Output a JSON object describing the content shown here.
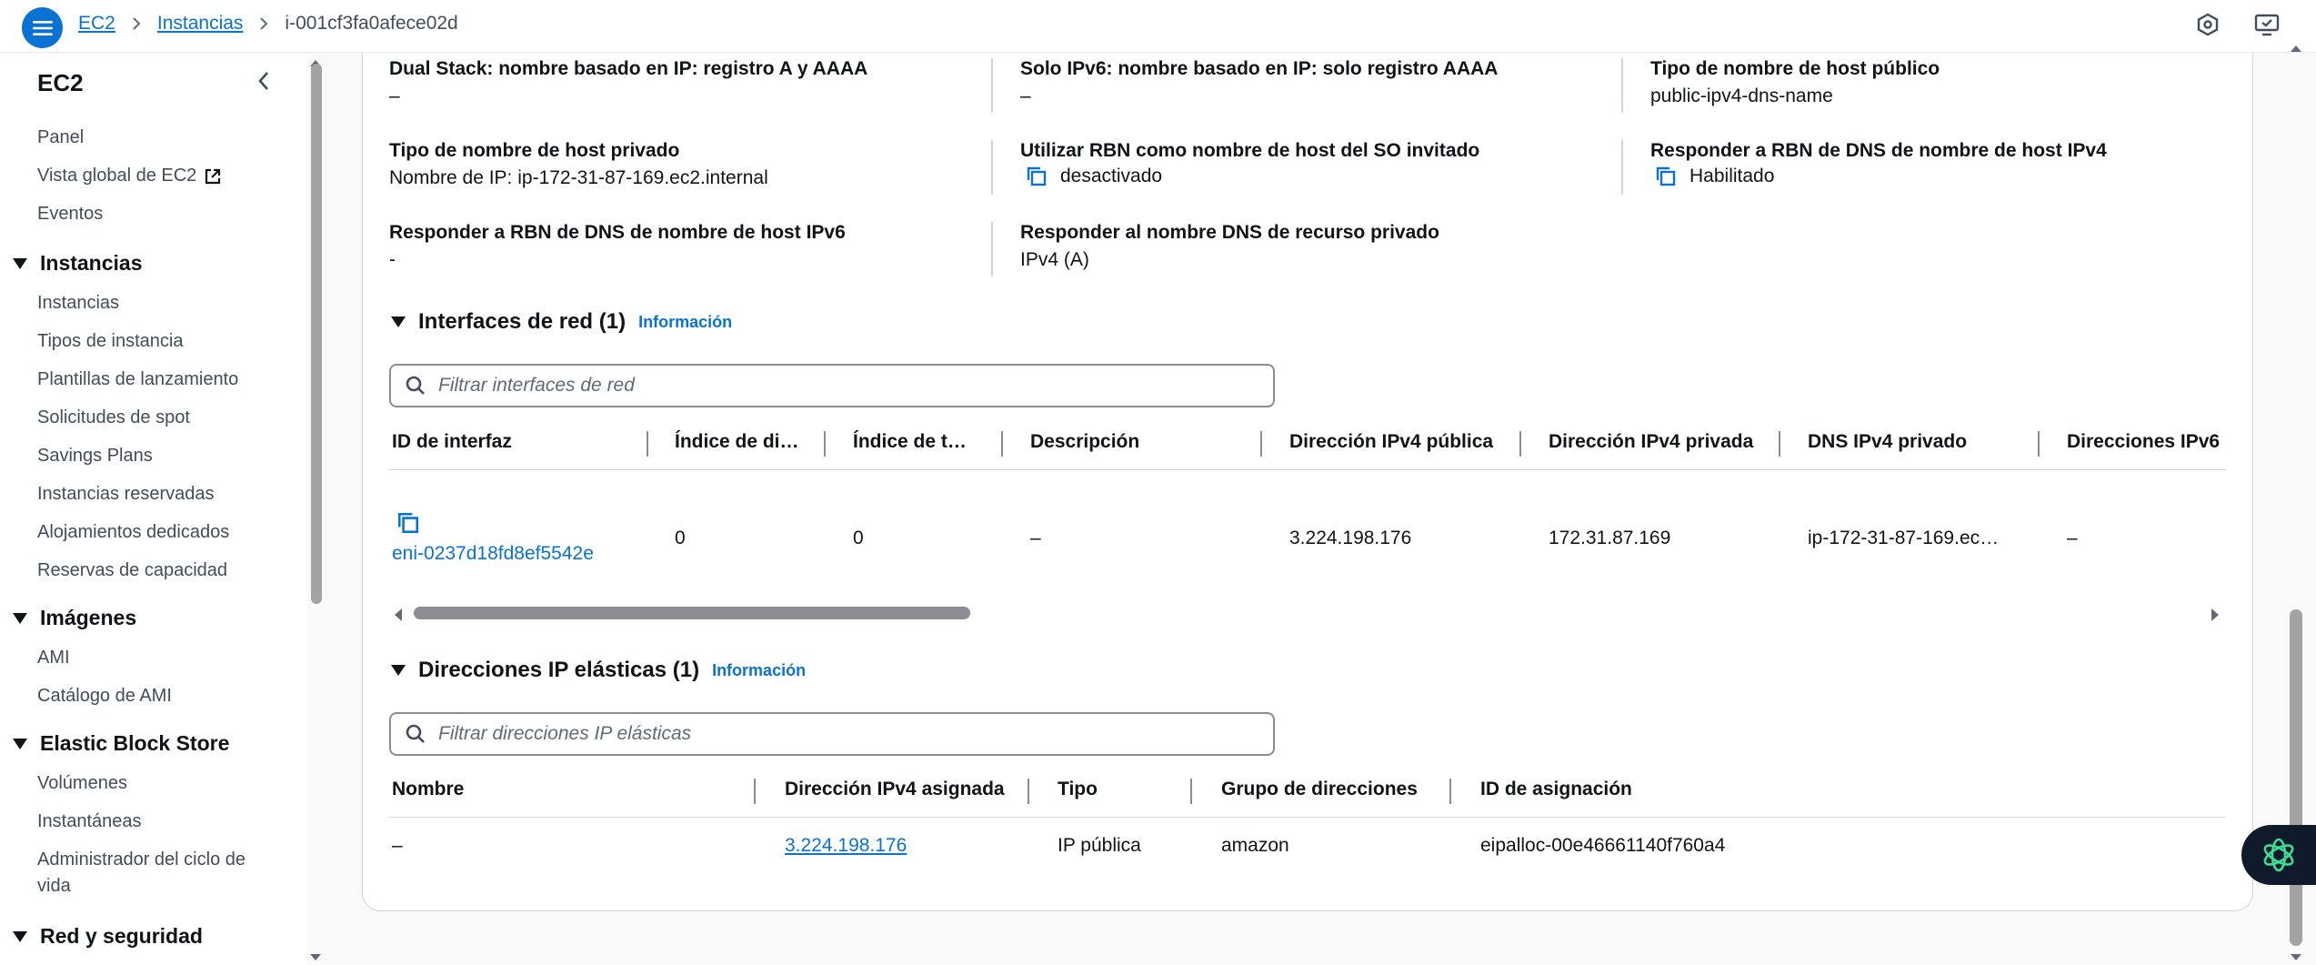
{
  "header": {
    "breadcrumbs": [
      "EC2",
      "Instancias"
    ],
    "current": "i-001cf3fa0afece02d"
  },
  "sidebar": {
    "title": "EC2",
    "top_links": [
      "Panel",
      "Vista global de EC2",
      "Eventos"
    ],
    "sections": [
      {
        "label": "Instancias",
        "items": [
          "Instancias",
          "Tipos de instancia",
          "Plantillas de lanzamiento",
          "Solicitudes de spot",
          "Savings Plans",
          "Instancias reservadas",
          "Alojamientos dedicados",
          "Reservas de capacidad"
        ]
      },
      {
        "label": "Imágenes",
        "items": [
          "AMI",
          "Catálogo de AMI"
        ]
      },
      {
        "label": "Elastic Block Store",
        "items": [
          "Volúmenes",
          "Instantáneas",
          "Administrador del ciclo de",
          "vida"
        ]
      },
      {
        "label": "Red y seguridad",
        "items": []
      }
    ]
  },
  "details": [
    {
      "label": "Dual Stack: nombre basado en IP: registro A y AAAA",
      "value": "–"
    },
    {
      "label": "Solo IPv6: nombre basado en IP: solo registro AAAA",
      "value": "–"
    },
    {
      "label": "Tipo de nombre de host público",
      "value": "public-ipv4-dns-name"
    },
    {
      "label": "Tipo de nombre de host privado",
      "value": "Nombre de IP: ip-172-31-87-169.ec2.internal"
    },
    {
      "label": "Utilizar RBN como nombre de host del SO invitado",
      "value": "desactivado"
    },
    {
      "label": "Responder a RBN de DNS de nombre de host IPv4",
      "value": "Habilitado"
    },
    {
      "label": "Responder a RBN de DNS de nombre de host IPv6",
      "value": "-"
    },
    {
      "label": "Responder al nombre DNS de recurso privado",
      "value": "IPv4 (A)"
    }
  ],
  "network": {
    "title": "Interfaces de red (1)",
    "info": "Información",
    "filter_placeholder": "Filtrar interfaces de red",
    "columns": [
      "ID de interfaz",
      "Índice de di…",
      "Índice de t…",
      "Descripción",
      "Dirección IPv4 pública",
      "Dirección IPv4 privada",
      "DNS IPv4 privado",
      "Direcciones IPv6"
    ],
    "rows": [
      [
        "eni-0237d18fd8ef5542e",
        "0",
        "0",
        "–",
        "3.224.198.176",
        "172.31.87.169",
        "ip-172-31-87-169.ec…",
        "–"
      ]
    ]
  },
  "elastic": {
    "title": "Direcciones IP elásticas (1)",
    "info": "Información",
    "filter_placeholder": "Filtrar direcciones IP elásticas",
    "columns": [
      "Nombre",
      "Dirección IPv4 asignada",
      "Tipo",
      "Grupo de direcciones",
      "ID de asignación"
    ],
    "rows": [
      [
        "–",
        "3.224.198.176",
        "IP pública",
        "amazon",
        "eipalloc-00e46661140f760a4"
      ]
    ]
  },
  "colors": {
    "accent": "#0972d3",
    "text": "#0f141a",
    "divider": "#d1d5db"
  }
}
